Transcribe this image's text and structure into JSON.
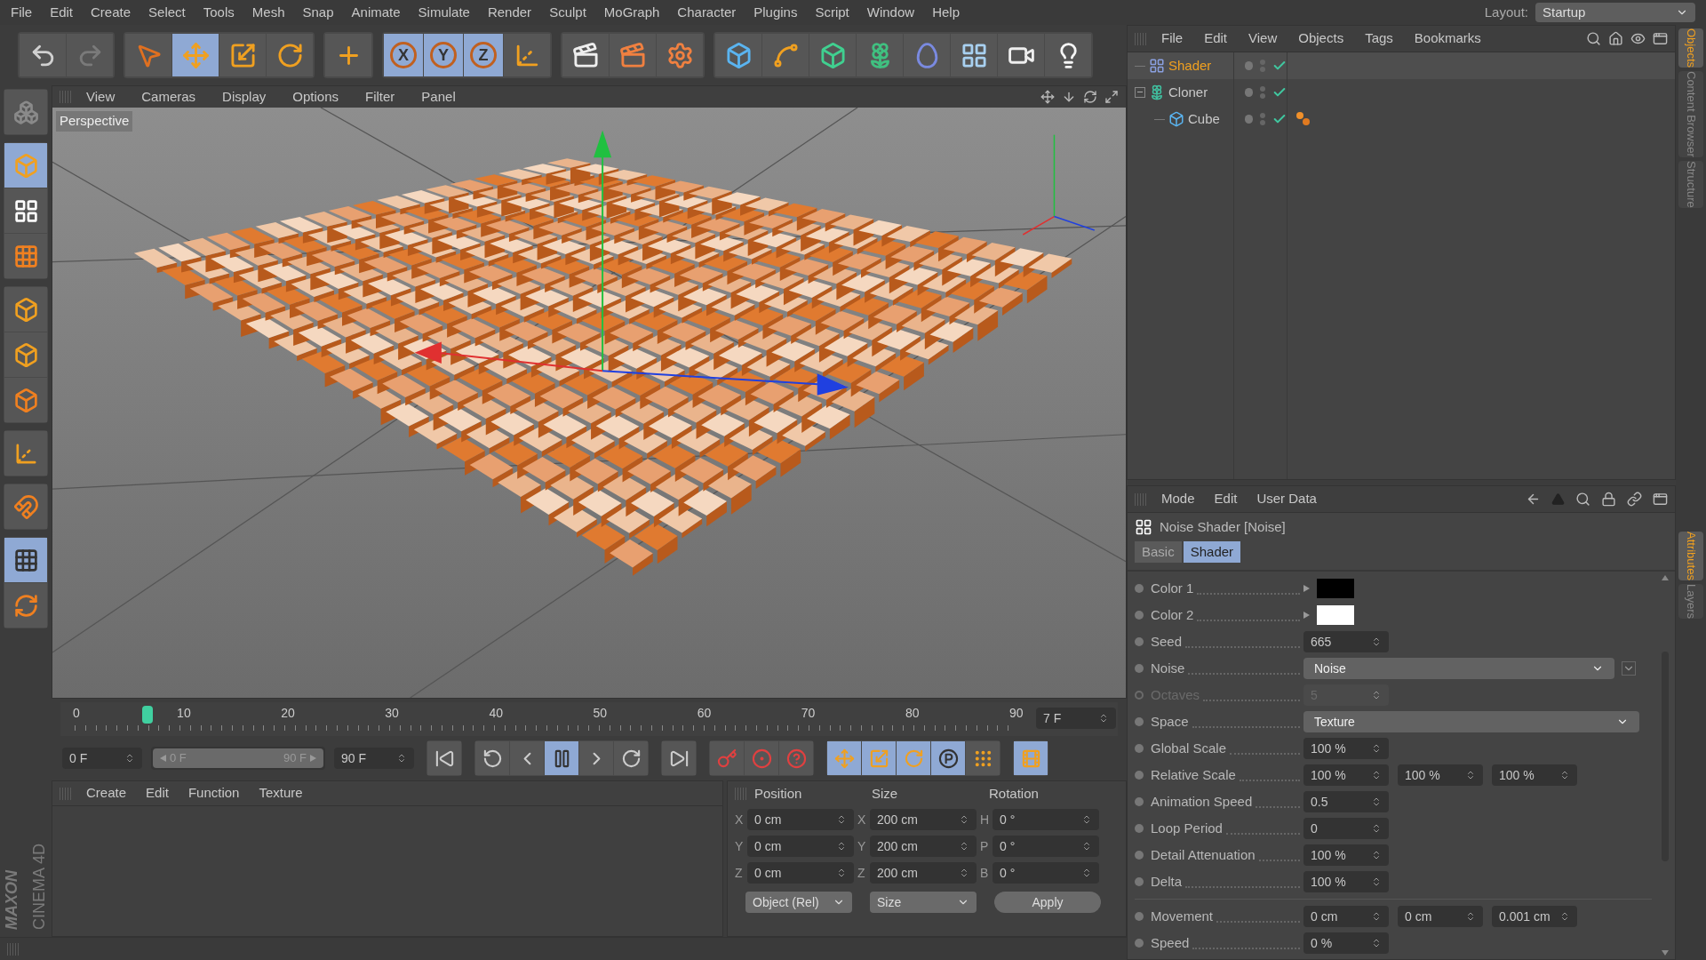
{
  "menu": [
    "File",
    "Edit",
    "Create",
    "Select",
    "Tools",
    "Mesh",
    "Snap",
    "Animate",
    "Simulate",
    "Render",
    "Sculpt",
    "MoGraph",
    "Character",
    "Plugins",
    "Script",
    "Window",
    "Help"
  ],
  "layout": {
    "label": "Layout:",
    "value": "Startup"
  },
  "toolbar": [
    [
      {
        "kind": "undo",
        "selected": false
      },
      {
        "kind": "redo",
        "selected": false
      }
    ],
    [
      {
        "kind": "select",
        "selected": false
      },
      {
        "kind": "move",
        "selected": true
      },
      {
        "kind": "scale",
        "selected": false
      },
      {
        "kind": "rotate",
        "selected": false
      }
    ],
    [
      {
        "kind": "add",
        "selected": false
      }
    ],
    [
      {
        "kind": "axis_lock",
        "label": "X",
        "selected": true
      },
      {
        "kind": "axis_lock",
        "label": "Y",
        "selected": true
      },
      {
        "kind": "axis_lock",
        "label": "Z",
        "selected": true
      },
      {
        "kind": "coords",
        "selected": false
      }
    ],
    [
      {
        "kind": "render_view",
        "selected": false
      },
      {
        "kind": "render",
        "selected": false
      },
      {
        "kind": "render_settings",
        "selected": false
      }
    ],
    [
      {
        "kind": "cube",
        "selected": false
      },
      {
        "kind": "spline",
        "selected": false
      },
      {
        "kind": "nurbs",
        "selected": false
      },
      {
        "kind": "array",
        "selected": false
      },
      {
        "kind": "deformer",
        "selected": false
      },
      {
        "kind": "scene",
        "selected": false
      },
      {
        "kind": "camera",
        "selected": false
      },
      {
        "kind": "light",
        "selected": false
      }
    ]
  ],
  "tools": [
    [
      {
        "kind": "model",
        "selected": false
      }
    ],
    [
      {
        "kind": "object",
        "selected": true
      },
      {
        "kind": "texture",
        "selected": false
      },
      {
        "kind": "workplane",
        "selected": false
      }
    ],
    [
      {
        "kind": "points",
        "selected": false
      },
      {
        "kind": "edges",
        "selected": false
      },
      {
        "kind": "polygons",
        "selected": false
      }
    ],
    [
      {
        "kind": "axis",
        "selected": false
      }
    ],
    [
      {
        "kind": "magnet",
        "selected": false
      }
    ],
    [
      {
        "kind": "snap_lock",
        "selected": true
      },
      {
        "kind": "snap_rotate",
        "selected": false
      }
    ]
  ],
  "viewport": {
    "menu": [
      "View",
      "Cameras",
      "Display",
      "Options",
      "Filter",
      "Panel"
    ],
    "camera": "Perspective"
  },
  "timeline": {
    "ticks": [
      "0",
      "10",
      "20",
      "30",
      "40",
      "50",
      "60",
      "70",
      "80",
      "90"
    ],
    "level": 0.078,
    "frame": "7 F"
  },
  "transport": {
    "start": "0 F",
    "range": {
      "start": "0 F",
      "end": "90 F",
      "level": 1
    },
    "end": "90 F",
    "buttons": [
      [
        {
          "kind": "first",
          "selected": false
        }
      ],
      [
        {
          "kind": "prev_key",
          "selected": false
        },
        {
          "kind": "prev",
          "selected": false
        },
        {
          "kind": "pause",
          "selected": true
        },
        {
          "kind": "next",
          "selected": false
        },
        {
          "kind": "next_key",
          "selected": false
        }
      ],
      [
        {
          "kind": "last",
          "selected": false
        }
      ],
      [
        {
          "kind": "record",
          "selected": false
        },
        {
          "kind": "autokey",
          "selected": false
        },
        {
          "kind": "keyset",
          "selected": false
        }
      ],
      [
        {
          "kind": "key_pos",
          "selected": true
        },
        {
          "kind": "key_scale",
          "selected": true
        },
        {
          "kind": "key_rot",
          "selected": true
        },
        {
          "kind": "key_param",
          "selected": true
        },
        {
          "kind": "key_points",
          "selected": false
        }
      ],
      [
        {
          "kind": "timeline",
          "selected": true
        }
      ]
    ]
  },
  "material_manager": {
    "menu": [
      "Create",
      "Edit",
      "Function",
      "Texture"
    ]
  },
  "coordinates": {
    "headers": [
      "Position",
      "Size",
      "Rotation"
    ],
    "rows": [
      [
        {
          "axis": "X",
          "value": "0 cm"
        },
        {
          "axis": "X",
          "value": "200 cm"
        },
        {
          "axis": "H",
          "value": "0 °"
        }
      ],
      [
        {
          "axis": "Y",
          "value": "0 cm"
        },
        {
          "axis": "Y",
          "value": "200 cm"
        },
        {
          "axis": "P",
          "value": "0 °"
        }
      ],
      [
        {
          "axis": "Z",
          "value": "0 cm"
        },
        {
          "axis": "Z",
          "value": "200 cm"
        },
        {
          "axis": "B",
          "value": "0 °"
        }
      ]
    ],
    "modes": [
      "Object (Rel)",
      "Size"
    ],
    "apply": "Apply"
  },
  "logo": {
    "brand": "MAXON",
    "product": "CINEMA 4D"
  },
  "object_manager": {
    "menu": [
      "File",
      "Edit",
      "View",
      "Objects",
      "Tags",
      "Bookmarks"
    ],
    "objects": [
      {
        "name": "Shader",
        "kind": "shader",
        "selected": true,
        "enabled": true,
        "tagged": false
      },
      {
        "name": "Cloner",
        "kind": "cloner",
        "selected": false,
        "enabled": true,
        "tagged": false,
        "expanded": true,
        "children": [
          {
            "name": "Cube",
            "kind": "cube",
            "selected": false,
            "enabled": true,
            "tagged": true
          }
        ]
      }
    ]
  },
  "side_tabs_top": [
    {
      "label": "Objects",
      "selected": true
    },
    {
      "label": "Content Browser",
      "selected": false
    },
    {
      "label": "Structure",
      "selected": false
    }
  ],
  "side_tabs_bottom": [
    {
      "label": "Attributes",
      "selected": true
    },
    {
      "label": "Layers",
      "selected": false
    }
  ],
  "attributes": {
    "menu": [
      "Mode",
      "Edit",
      "User Data"
    ],
    "title": "Noise Shader [Noise]",
    "tabs": [
      {
        "label": "Basic",
        "selected": false
      },
      {
        "label": "Shader",
        "selected": true
      }
    ],
    "groups": [
      [
        {
          "kind": "color",
          "label": "Color 1",
          "color": "#000000",
          "disabled": false
        },
        {
          "kind": "color",
          "label": "Color 2",
          "color": "#ffffff",
          "disabled": false
        },
        {
          "kind": "number",
          "label": "Seed",
          "values": [
            "665"
          ],
          "disabled": false
        },
        {
          "kind": "dropdown",
          "label": "Noise",
          "value": "Noise",
          "menu_button": true,
          "disabled": false
        },
        {
          "kind": "number",
          "label": "Octaves",
          "values": [
            "5"
          ],
          "disabled": true
        },
        {
          "kind": "dropdown",
          "label": "Space",
          "value": "Texture",
          "menu_button": false,
          "disabled": false
        },
        {
          "kind": "number",
          "label": "Global Scale",
          "values": [
            "100 %"
          ],
          "disabled": false
        },
        {
          "kind": "number",
          "label": "Relative Scale",
          "values": [
            "100 %",
            "100 %",
            "100 %"
          ],
          "disabled": false
        },
        {
          "kind": "number",
          "label": "Animation Speed",
          "values": [
            "0.5"
          ],
          "disabled": false
        },
        {
          "kind": "number",
          "label": "Loop Period",
          "values": [
            "0"
          ],
          "disabled": false
        },
        {
          "kind": "number",
          "label": "Detail Attenuation",
          "values": [
            "100 %"
          ],
          "disabled": false
        },
        {
          "kind": "number",
          "label": "Delta",
          "values": [
            "100 %"
          ],
          "disabled": false
        }
      ],
      [
        {
          "kind": "number",
          "label": "Movement",
          "values": [
            "0 cm",
            "0 cm",
            "0.001 cm"
          ],
          "disabled": false
        },
        {
          "kind": "number",
          "label": "Speed",
          "values": [
            "0 %"
          ],
          "disabled": false
        }
      ]
    ]
  }
}
